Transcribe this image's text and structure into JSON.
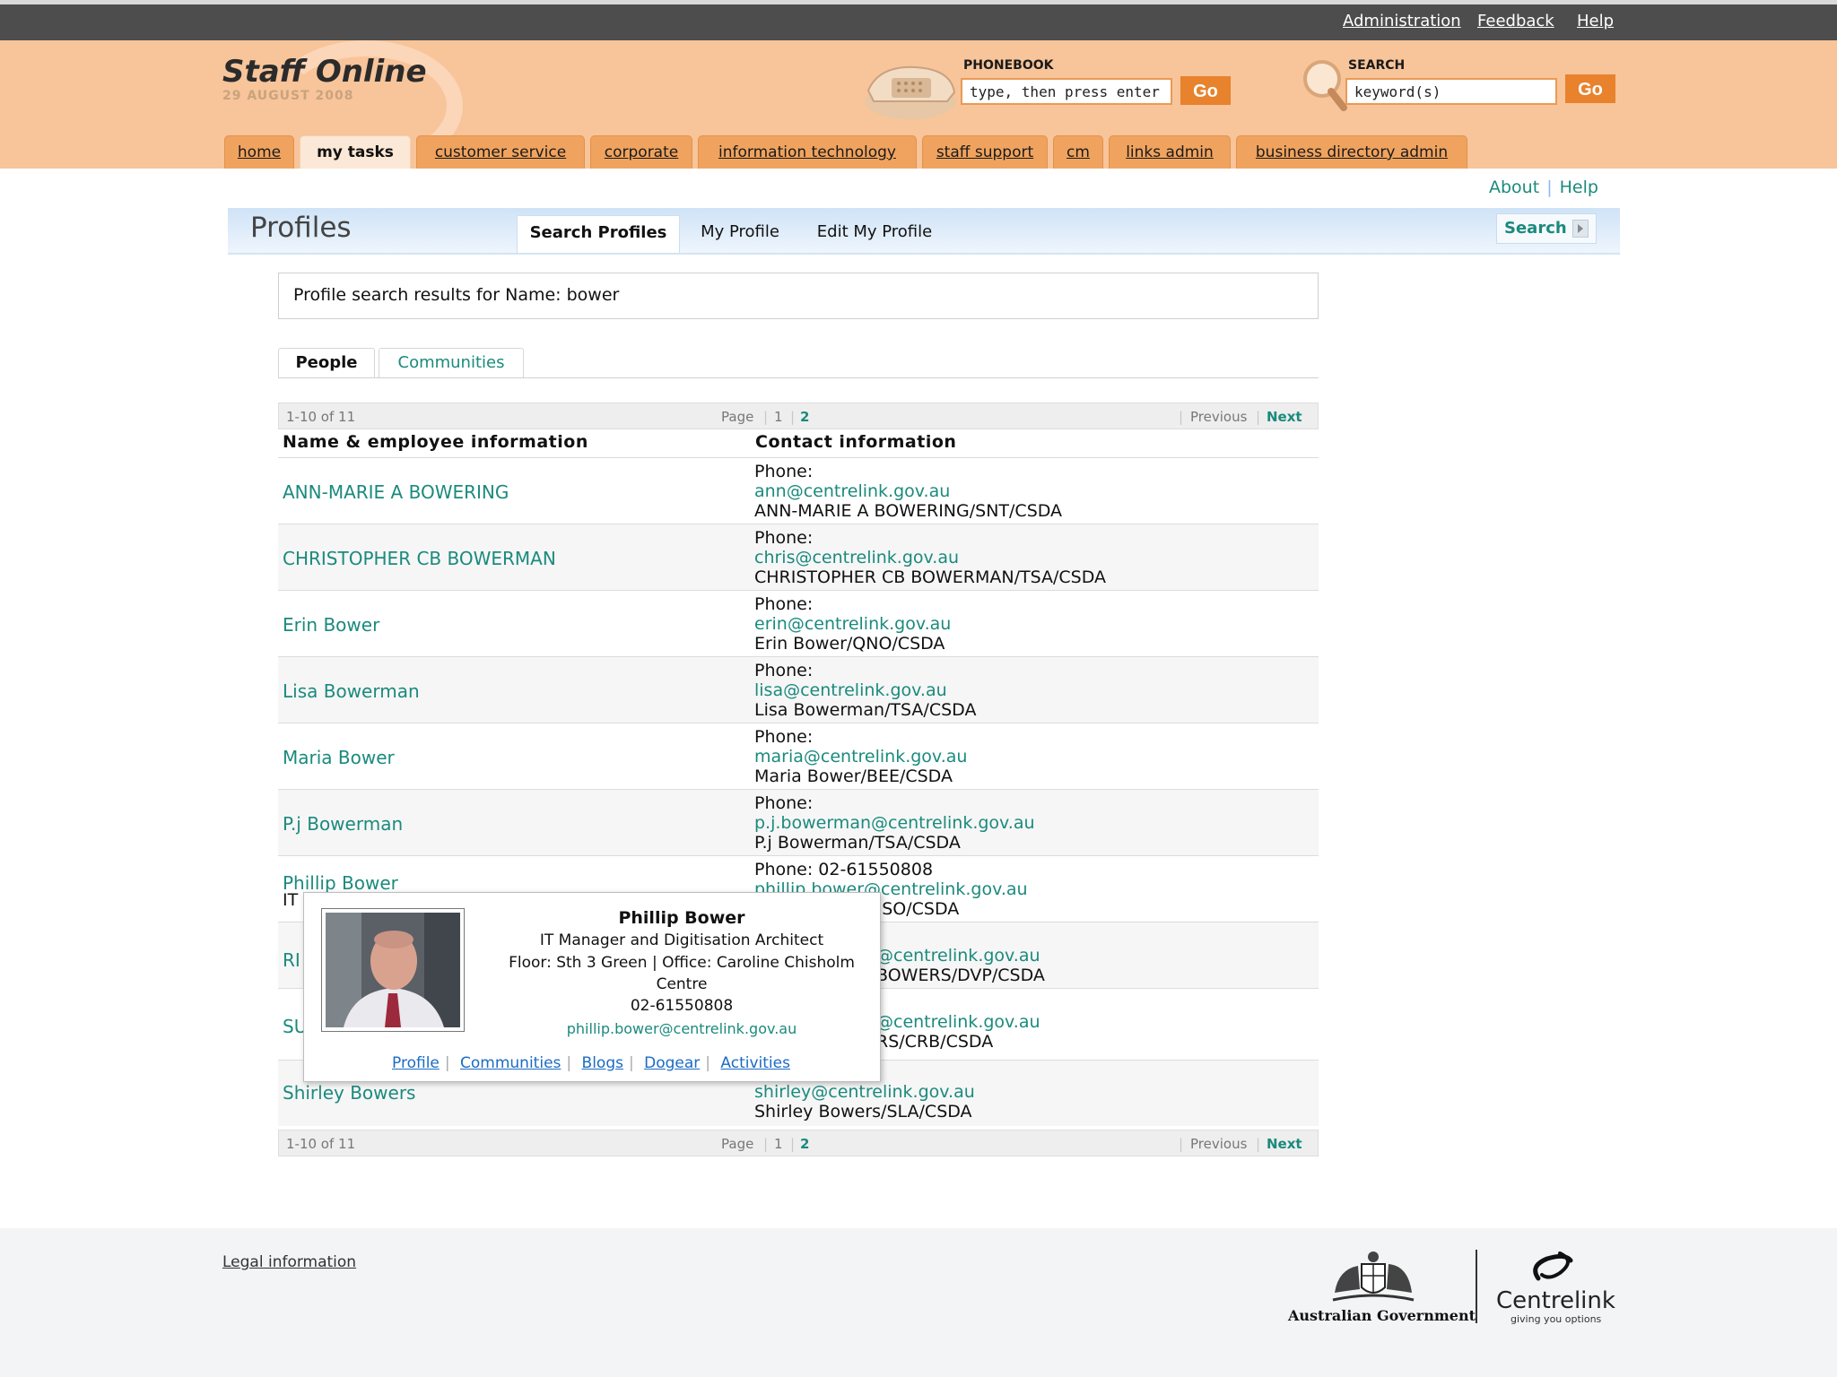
{
  "top_links": [
    "Administration",
    "Feedback",
    "Help"
  ],
  "site": {
    "title": "Staff Online",
    "date": "29 AUGUST 2008"
  },
  "phonebook": {
    "label": "PHONEBOOK",
    "value": "type, then press enter",
    "go": "Go"
  },
  "search": {
    "label": "SEARCH",
    "value": "keyword(s)",
    "go": "Go"
  },
  "nav_tabs": [
    "home",
    "my tasks",
    "customer service",
    "corporate",
    "information technology",
    "staff support",
    "cm",
    "links admin",
    "business directory admin"
  ],
  "active_nav": "my tasks",
  "utility": {
    "about": "About",
    "help": "Help"
  },
  "profiles": {
    "title": "Profiles",
    "tabs": [
      "Search Profiles",
      "My Profile",
      "Edit My Profile"
    ],
    "search_button": "Search"
  },
  "summary": "Profile search results for Name: bower",
  "result_tabs": [
    "People",
    "Communities"
  ],
  "pager": {
    "range": "1-10 of 11",
    "page_label": "Page",
    "pages": [
      "1",
      "2"
    ],
    "previous": "Previous",
    "next": "Next"
  },
  "columns": {
    "name": "Name & employee information",
    "contact": "Contact information"
  },
  "results": [
    {
      "name": "ANN-MARIE A BOWERING",
      "phone": "Phone:",
      "email": "ann@centrelink.gov.au",
      "notes": "ANN-MARIE A BOWERING/SNT/CSDA"
    },
    {
      "name": "CHRISTOPHER CB BOWERMAN",
      "phone": "Phone:",
      "email": "chris@centrelink.gov.au",
      "notes": "CHRISTOPHER CB BOWERMAN/TSA/CSDA"
    },
    {
      "name": "Erin Bower",
      "phone": "Phone:",
      "email": "erin@centrelink.gov.au",
      "notes": "Erin Bower/QNO/CSDA"
    },
    {
      "name": "Lisa Bowerman",
      "phone": "Phone:",
      "email": "lisa@centrelink.gov.au",
      "notes": "Lisa Bowerman/TSA/CSDA"
    },
    {
      "name": "Maria Bower",
      "phone": "Phone:",
      "email": "maria@centrelink.gov.au",
      "notes": "Maria Bower/BEE/CSDA"
    },
    {
      "name": "P.j Bowerman",
      "phone": "Phone:",
      "email": "p.j.bowerman@centrelink.gov.au",
      "notes": "P.j Bowerman/TSA/CSDA"
    },
    {
      "name": "Phillip Bower",
      "sub": "IT",
      "phone": "Phone: 02-61550808",
      "email": "phillip.bower@centrelink.gov.au",
      "notes": "NSO/CSDA"
    },
    {
      "name": "RI",
      "email": "@centrelink.gov.au",
      "notes": "BOWERS/DVP/CSDA"
    },
    {
      "name": "SU",
      "email": "@centrelink.gov.au",
      "notes": "RS/CRB/CSDA"
    },
    {
      "name": "Shirley Bowers",
      "email": "shirley@centrelink.gov.au",
      "notes": "Shirley Bowers/SLA/CSDA"
    }
  ],
  "popup": {
    "name": "Phillip Bower",
    "title": "IT Manager and Digitisation Architect",
    "location": "Floor: Sth 3 Green | Office: Caroline Chisholm",
    "location2": "Centre",
    "phone": "02-61550808",
    "email": "phillip.bower@centrelink.gov.au",
    "links": [
      "Profile",
      "Communities",
      "Blogs",
      "Dogear",
      "Activities"
    ]
  },
  "footer": {
    "legal": "Legal information",
    "gov": "Australian Government",
    "brand": "Centrelink",
    "tagline": "giving you options"
  }
}
